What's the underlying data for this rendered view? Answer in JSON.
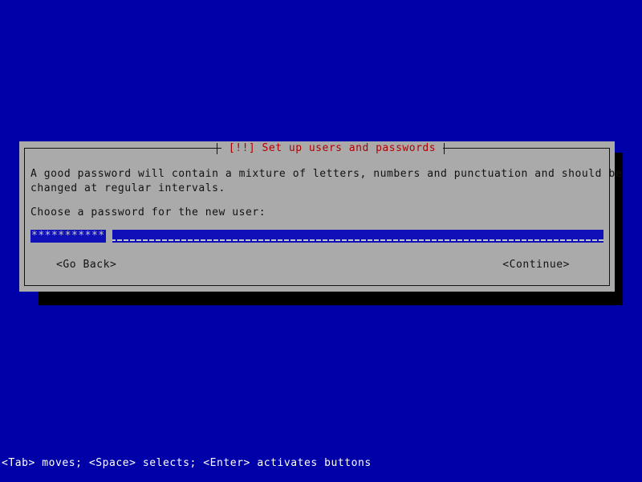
{
  "screen": {
    "background_color": "#0000a8",
    "foreground_color": "#ffffff"
  },
  "dialog": {
    "title": "[!!] Set up users and passwords",
    "title_color": "#b00000",
    "panel_color": "#aaaaaa",
    "border_color": "#121212",
    "shadow_color": "#000000",
    "body_lines": [
      "A good password will contain a mixture of letters, numbers and punctuation and should be",
      "changed at regular intervals."
    ],
    "prompt": "Choose a password for the new user:",
    "password_field": {
      "name": "password",
      "masked_value": "***********",
      "mask_character": "*",
      "character_count": 11,
      "placeholder": "",
      "field_color": "#1010b8",
      "text_color": "#c8c8c8",
      "cursor_visible": true
    },
    "buttons": [
      {
        "id": "go-back",
        "label": "<Go Back>",
        "selected": false
      },
      {
        "id": "continue",
        "label": "<Continue>",
        "selected": false
      }
    ]
  },
  "status_bar": {
    "text": "<Tab> moves; <Space> selects; <Enter> activates buttons"
  }
}
